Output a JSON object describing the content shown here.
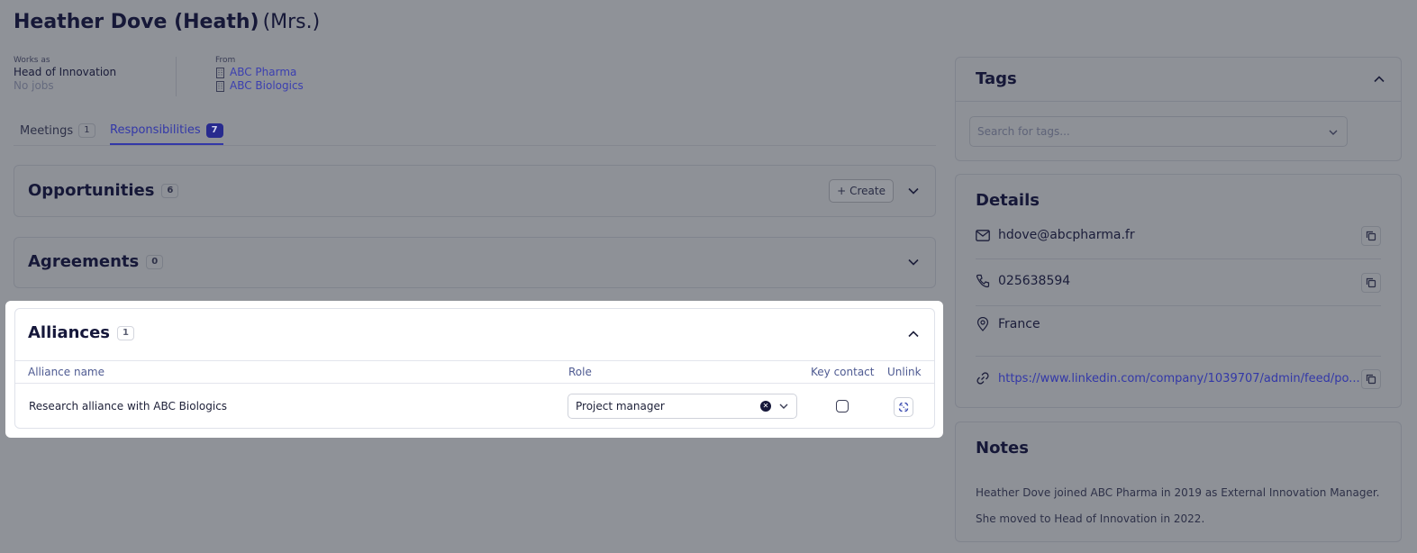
{
  "person": {
    "name": "Heather Dove (Heath)",
    "honorific": "(Mrs.)",
    "works_as_label": "Works as",
    "job_title": "Head of Innovation",
    "jobs_text": "No jobs",
    "from_label": "From",
    "companies": [
      "ABC Pharma",
      "ABC Biologics"
    ]
  },
  "tabs": [
    {
      "label": "Meetings",
      "count": "1"
    },
    {
      "label": "Responsibilities",
      "count": "7"
    }
  ],
  "opportunities": {
    "title": "Opportunities",
    "count": "6",
    "create_label": "Create"
  },
  "agreements": {
    "title": "Agreements",
    "count": "0"
  },
  "alliances": {
    "title": "Alliances",
    "count": "1",
    "columns": {
      "name": "Alliance name",
      "role": "Role",
      "key_contact": "Key contact",
      "unlink": "Unlink"
    },
    "rows": [
      {
        "name": "Research alliance with ABC Biologics",
        "role": "Project manager",
        "key_contact": false
      }
    ]
  },
  "tags": {
    "title": "Tags",
    "placeholder": "Search for tags..."
  },
  "details": {
    "title": "Details",
    "email": "hdove@abcpharma.fr",
    "phone": "025638594",
    "country": "France",
    "linkedin": "https://www.linkedin.com/company/1039707/admin/feed/po..."
  },
  "notes": {
    "title": "Notes",
    "lines": [
      "Heather Dove joined ABC Pharma in 2019 as External Innovation Manager.",
      "She moved to Head of Innovation in 2022."
    ]
  },
  "colors": {
    "accent": "#3338a8",
    "overlay": "#8f9298",
    "dark": "#161838"
  }
}
